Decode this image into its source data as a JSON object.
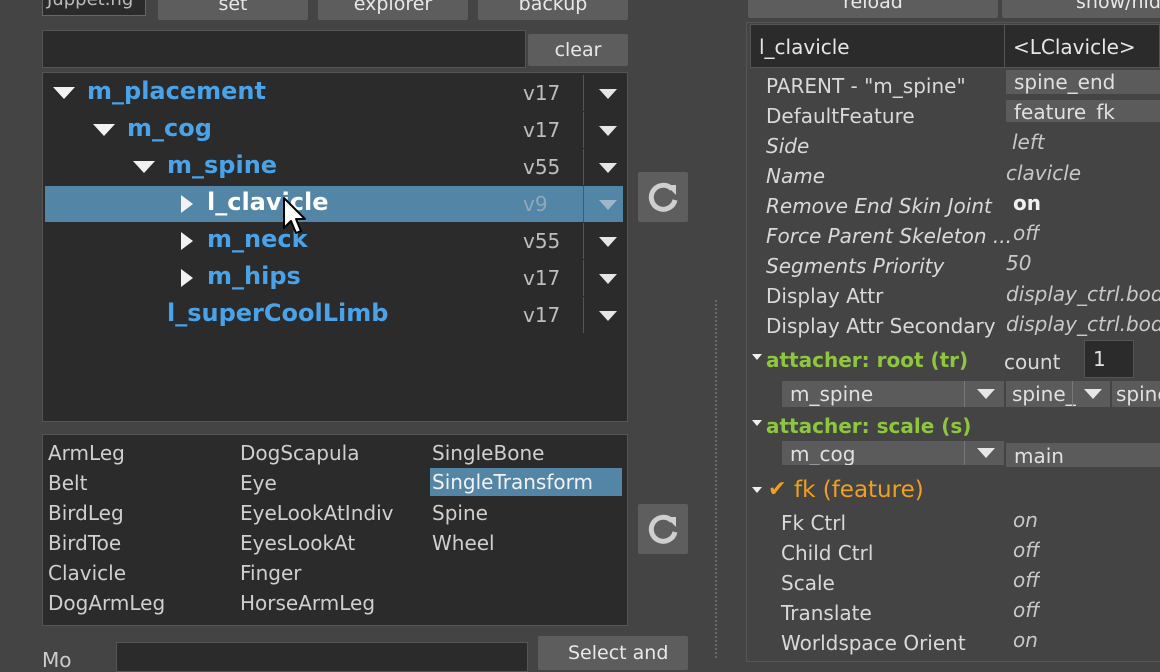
{
  "top_buttons": {
    "field_text": "Juppet.ng",
    "set": "set",
    "explorer": "explorer",
    "backup": "backup",
    "reload": "reload",
    "show_hide": "show/hid"
  },
  "filter": {
    "value": "",
    "clear_label": "clear"
  },
  "tree": [
    {
      "label": "m_placement",
      "version": "v17",
      "selected": false
    },
    {
      "label": "m_cog",
      "version": "v17",
      "selected": false
    },
    {
      "label": "m_spine",
      "version": "v55",
      "selected": false
    },
    {
      "label": "l_clavicle",
      "version": "v9",
      "selected": true
    },
    {
      "label": "m_neck",
      "version": "v55",
      "selected": false
    },
    {
      "label": "m_hips",
      "version": "v17",
      "selected": false
    },
    {
      "label": "l_superCoolLimb",
      "version": "v17",
      "selected": false
    }
  ],
  "types": {
    "col1": [
      "ArmLeg",
      "Belt",
      "BirdLeg",
      "BirdToe",
      "Clavicle",
      "DogArmLeg"
    ],
    "col2": [
      "DogScapula",
      "Eye",
      "EyeLookAtIndiv",
      "EyesLookAt",
      "Finger",
      "HorseArmLeg"
    ],
    "col3": [
      "SingleBone",
      "SingleTransform",
      "Spine",
      "Wheel"
    ],
    "selected": "SingleTransform"
  },
  "bottom": {
    "label": "Mo",
    "value": "",
    "button": "Select and"
  },
  "inspector": {
    "header_name": "l_clavicle",
    "header_type": "<LClavicle>",
    "parent_label": "PARENT - \"m_spine\"",
    "parent_value": "spine_end",
    "default_feature_label": "DefaultFeature",
    "default_feature_value": "feature_fk",
    "attrs": [
      {
        "label": "Side",
        "value": "left"
      },
      {
        "label": "Name",
        "value": "clavicle"
      },
      {
        "label": "Remove End Skin Joint",
        "value": "on"
      },
      {
        "label": "Force Parent Skeleton ...",
        "value": "off"
      },
      {
        "label": "Segments Priority",
        "value": "50"
      }
    ],
    "display_attr_label": "Display Attr",
    "display_attr_value": "display_ctrl.body",
    "display_attr2_label": "Display Attr Secondary",
    "display_attr2_value": "display_ctrl.body",
    "attacher_root": {
      "title": "attacher: root (tr)",
      "count_label": "count",
      "count_value": "1",
      "combo": "m_spine",
      "combo2": "spine_",
      "combo3": "spine"
    },
    "attacher_scale": {
      "title": "attacher: scale (s)",
      "combo": "m_cog",
      "combo2": "main"
    },
    "feature": {
      "title": "fk (feature)",
      "check": "✔",
      "attrs": [
        {
          "label": "Fk Ctrl",
          "value": "on"
        },
        {
          "label": "Child Ctrl",
          "value": "off"
        },
        {
          "label": "Scale",
          "value": "off"
        },
        {
          "label": "Translate",
          "value": "off"
        },
        {
          "label": "Worldspace Orient",
          "value": "on"
        }
      ]
    }
  },
  "colors": {
    "background": "#444444",
    "panel": "#2b2b2b",
    "selection": "#5285a6",
    "tree_label": "#4aa3e8",
    "section_green": "#8ec63f",
    "feature_orange": "#f0a020"
  }
}
